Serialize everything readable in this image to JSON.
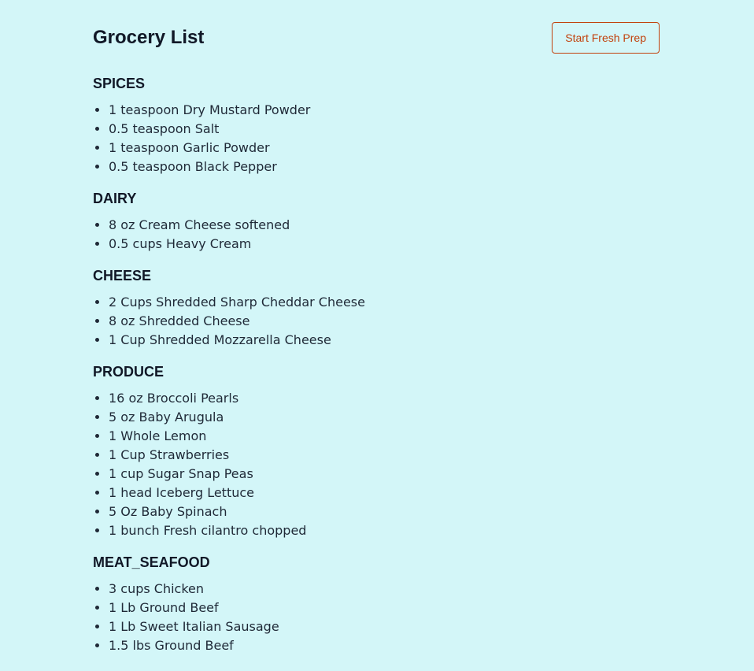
{
  "header": {
    "title": "Grocery List",
    "button_label": "Start Fresh Prep"
  },
  "colors": {
    "background": "#d3f6f8",
    "button_accent": "#c2410c",
    "text": "#111827"
  },
  "sections": [
    {
      "name": "SPICES",
      "items": [
        "1 teaspoon Dry Mustard Powder",
        "0.5 teaspoon Salt",
        "1 teaspoon Garlic Powder",
        "0.5 teaspoon Black Pepper"
      ]
    },
    {
      "name": "DAIRY",
      "items": [
        "8 oz Cream Cheese softened",
        "0.5 cups Heavy Cream"
      ]
    },
    {
      "name": "CHEESE",
      "items": [
        "2 Cups Shredded Sharp Cheddar Cheese",
        "8 oz Shredded Cheese",
        "1 Cup Shredded Mozzarella Cheese"
      ]
    },
    {
      "name": "PRODUCE",
      "items": [
        "16 oz Broccoli Pearls",
        "5 oz Baby Arugula",
        "1 Whole Lemon",
        "1 Cup Strawberries",
        "1 cup Sugar Snap Peas",
        "1 head Iceberg Lettuce",
        "5 Oz Baby Spinach",
        "1 bunch Fresh cilantro chopped"
      ]
    },
    {
      "name": "MEAT_SEAFOOD",
      "items": [
        "3 cups Chicken",
        "1 Lb Ground Beef",
        "1 Lb Sweet Italian Sausage",
        "1.5 lbs Ground Beef"
      ]
    }
  ]
}
